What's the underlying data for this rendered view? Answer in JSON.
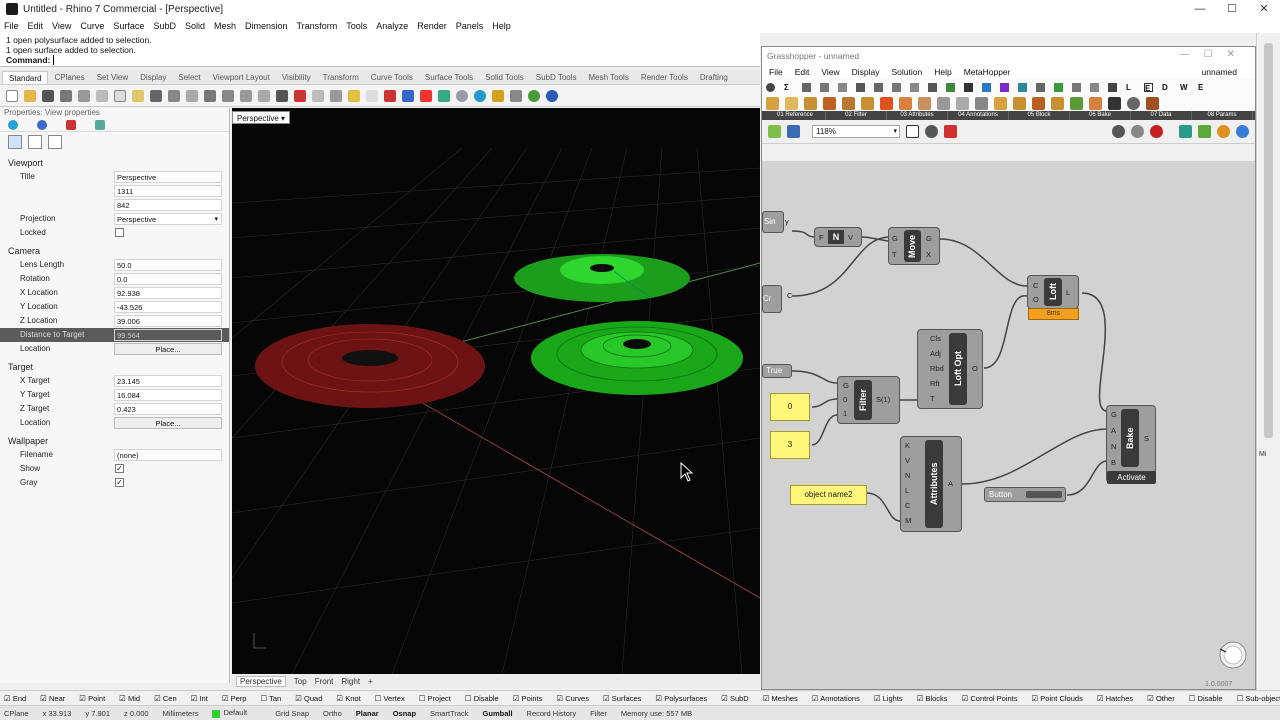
{
  "rhino": {
    "title": "Untitled - Rhino 7 Commercial - [Perspective]",
    "window_buttons": [
      "—",
      "☐",
      "✕"
    ],
    "menu": [
      "File",
      "Edit",
      "View",
      "Curve",
      "Surface",
      "SubD",
      "Solid",
      "Mesh",
      "Dimension",
      "Transform",
      "Tools",
      "Analyze",
      "Render",
      "Panels",
      "Help"
    ],
    "command_history": [
      "1 open polysurface added to selection.",
      "1 open surface added to selection."
    ],
    "command_prompt": "Command:",
    "toolbar_tabs": [
      "Standard",
      "CPlanes",
      "Set View",
      "Display",
      "Select",
      "Viewport Layout",
      "Visibility",
      "Transform",
      "Curve Tools",
      "Surface Tools",
      "Solid Tools",
      "SubD Tools",
      "Mesh Tools",
      "Render Tools",
      "Drafting"
    ],
    "active_tab": "Standard"
  },
  "properties": {
    "header": "Properties: View properties",
    "viewport_section": "Viewport",
    "title_label": "Title",
    "title_value": "Perspective",
    "width_value": "1311",
    "height_value": "842",
    "projection_label": "Projection",
    "projection_value": "Perspective",
    "locked_label": "Locked",
    "camera_section": "Camera",
    "lens_label": "Lens Length",
    "lens_value": "50.0",
    "rotation_label": "Rotation",
    "rotation_value": "0.0",
    "xloc_label": "X Location",
    "xloc_value": "92.938",
    "yloc_label": "Y Location",
    "yloc_value": "-43.526",
    "zloc_label": "Z Location",
    "zloc_value": "39.006",
    "dist_label": "Distance to Target",
    "dist_value": "99.564",
    "location_label": "Location",
    "place_label": "Place...",
    "target_section": "Target",
    "xt_label": "X Target",
    "xt_value": "23.145",
    "yt_label": "Y Target",
    "yt_value": "16.084",
    "zt_label": "Z Target",
    "zt_value": "0.423",
    "tlocation_label": "Location",
    "tplace_label": "Place...",
    "wallpaper_section": "Wallpaper",
    "filename_label": "Filename",
    "filename_value": "(none)",
    "show_label": "Show",
    "gray_label": "Gray"
  },
  "viewport": {
    "tab_label": "Perspective",
    "bottom_tabs": [
      "Perspective",
      "Top",
      "Front",
      "Right",
      "+"
    ]
  },
  "grasshopper": {
    "title": "Grasshopper - unnamed",
    "menu": [
      "File",
      "Edit",
      "View",
      "Display",
      "Solution",
      "Help",
      "MetaHopper"
    ],
    "document_name": "unnamed",
    "icon_letters": [
      "L",
      "E",
      "D",
      "W",
      "E"
    ],
    "ribbon_tabs": [
      "01 Reference",
      "02 Filter",
      "03 Attributes",
      "04 Annotations",
      "05 Block",
      "06 Bake",
      "07 Data",
      "08 Params"
    ],
    "zoom": "118%",
    "components": {
      "move": {
        "name": "Move",
        "inputs": [
          "G",
          "T"
        ],
        "outputs": [
          "G",
          "X"
        ]
      },
      "loft": {
        "name": "Loft",
        "inputs": [
          "C",
          "O"
        ],
        "outputs": [
          "L"
        ],
        "timer": "8ms"
      },
      "loft_opt": {
        "name": "Loft Opt",
        "inputs": [
          "Cls",
          "Adj",
          "Rbd",
          "Rft",
          "T"
        ],
        "outputs": [
          "O"
        ]
      },
      "filter": {
        "name": "Filter",
        "inputs": [
          "G",
          "0",
          "1"
        ],
        "outputs": [
          "S(1)"
        ]
      },
      "attributes": {
        "name": "Attributes",
        "inputs": [
          "K",
          "V",
          "N",
          "L",
          "C",
          "M"
        ],
        "outputs": [
          "A"
        ]
      },
      "bake": {
        "name": "Bake",
        "inputs": [
          "G",
          "A",
          "N",
          "B"
        ],
        "outputs": [
          "S"
        ],
        "button": "Activate"
      },
      "button": {
        "name": "Button"
      },
      "sin_frag": "Sin",
      "y_pin": "y",
      "crv_frag": "Cr",
      "c_pin": "C",
      "fnv": {
        "name": "N",
        "left": "F",
        "right": "V"
      },
      "true_frag": "True"
    },
    "panels": {
      "p0": "0",
      "p3": "3",
      "pname": "object name2"
    },
    "version": "1.0.0007"
  },
  "osnap": [
    "End",
    "Near",
    "Point",
    "Mid",
    "Cen",
    "Int",
    "Perp",
    "Tan",
    "Quad",
    "Knot",
    "Vertex",
    "Project",
    "Disable",
    "Points",
    "Curves",
    "Surfaces",
    "Polysurfaces",
    "SubD",
    "Meshes",
    "Annotations",
    "Lights",
    "Blocks",
    "Control Points",
    "Point Clouds",
    "Hatches",
    "Other",
    "Disable",
    "Sub-object"
  ],
  "status": {
    "cplane": "CPlane",
    "x": "x 33.913",
    "y": "y 7.901",
    "z": "z 0.000",
    "units": "Millimeters",
    "layer": "Default",
    "items": [
      "Grid Snap",
      "Ortho",
      "Planar",
      "Osnap",
      "SmartTrack",
      "Gumball",
      "Record History",
      "Filter",
      "Memory use: 557 MB"
    ]
  },
  "right_strip_label": "Mi"
}
